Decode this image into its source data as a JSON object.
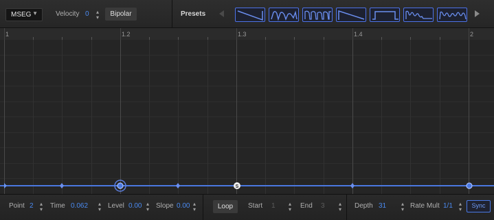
{
  "toolbar": {
    "mode_value": "MSEG",
    "velocity_label": "Velocity",
    "velocity_value": "0",
    "bipolar_label": "Bipolar",
    "presets_label": "Presets",
    "preset_shapes": [
      "ramp-down-shape",
      "stepped-hills-shape",
      "pulse-train-shape",
      "ramp-up-shape",
      "square-shape",
      "wavy-pulse-shape",
      "bumps-shape"
    ]
  },
  "ruler": {
    "labels": [
      "1",
      "1.2",
      "1.3",
      "1.4",
      "2"
    ]
  },
  "envelope": {
    "line_color": "#4a78e0",
    "start_marker": "S"
  },
  "bottom": {
    "point_label": "Point",
    "point_value": "2",
    "time_label": "Time",
    "time_value": "0.062",
    "level_label": "Level",
    "level_value": "0.00",
    "slope_label": "Slope",
    "slope_value": "0.00",
    "loop_label": "Loop",
    "start_label": "Start",
    "start_value": "1",
    "end_label": "End",
    "end_value": "3",
    "depth_label": "Depth",
    "depth_value": "31",
    "rate_label": "Rate Mult",
    "rate_value": "1/1",
    "sync_label": "Sync"
  },
  "colors": {
    "accent": "#4a8af0",
    "preset_border": "#4d72e8"
  }
}
